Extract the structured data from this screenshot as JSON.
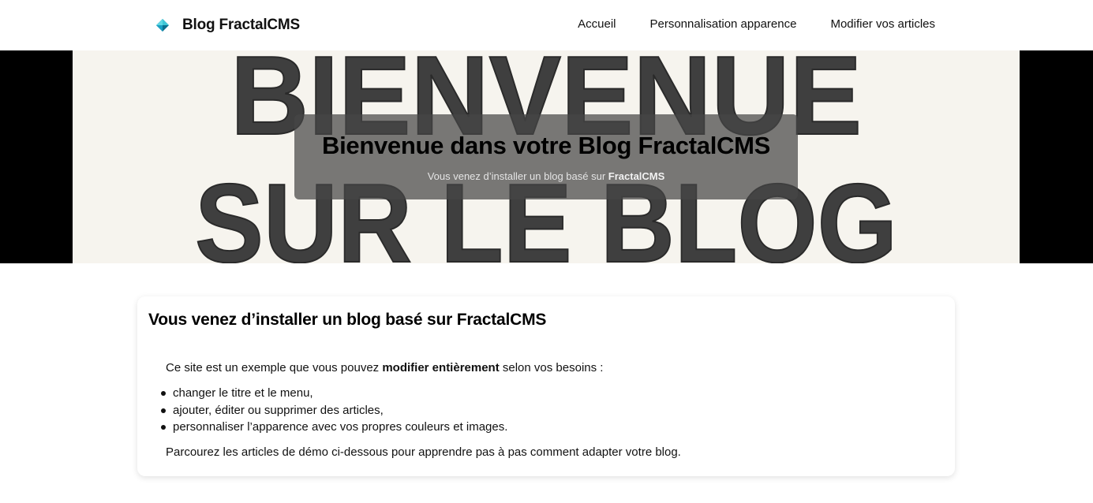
{
  "navbar": {
    "brand": "Blog FractalCMS",
    "links": [
      {
        "label": "Accueil"
      },
      {
        "label": "Personnalisation apparence"
      },
      {
        "label": "Modifier vos articles"
      }
    ],
    "brand_icon": "fractal-diamond-icon",
    "brand_colors": [
      "#1aa0c4",
      "#0b6f8e",
      "#3ec6d6"
    ]
  },
  "hero": {
    "background_text_line1": "BIENVENUE",
    "background_text_line2": "SUR LE BLOG",
    "title": "Bienvenue dans votre Blog FractalCMS",
    "subtitle_prefix": "Vous venez d’installer un blog basé sur ",
    "subtitle_strong": "FractalCMS"
  },
  "content": {
    "title": "Vous venez d’installer un blog basé sur FractalCMS",
    "intro_prefix": "Ce site est un exemple que vous pouvez ",
    "intro_strong": "modifier entièrement",
    "intro_suffix": " selon vos besoins :",
    "list": [
      "changer le titre et le menu,",
      "ajouter, éditer ou supprimer des articles,",
      "personnaliser l’apparence avec vos propres couleurs et images."
    ],
    "outro": "Parcourez les articles de démo ci-dessous pour apprendre pas à pas comment adapter votre blog."
  }
}
